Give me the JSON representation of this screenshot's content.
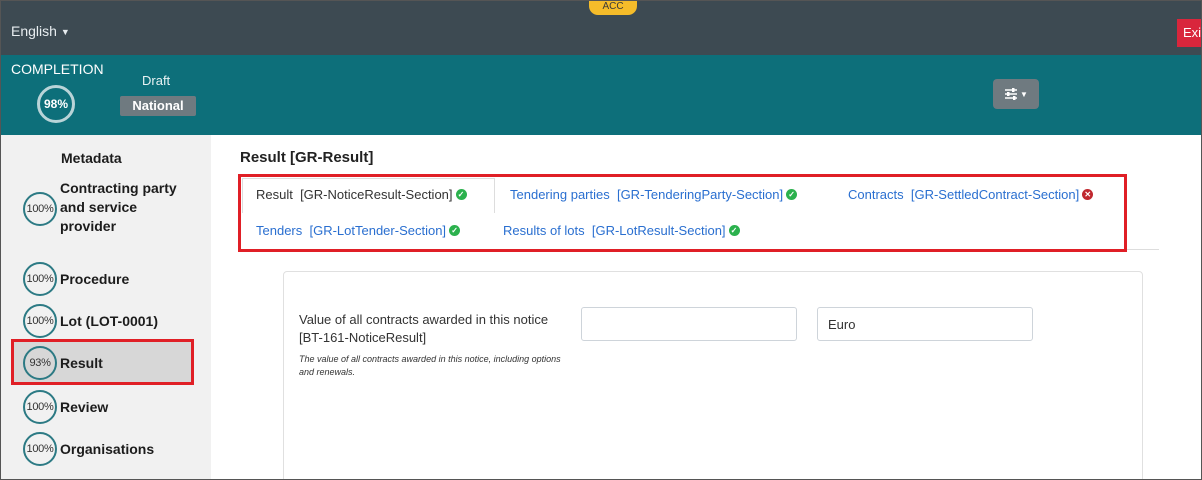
{
  "topbar": {
    "language": "English",
    "environment_badge": "ACC",
    "exit_label": "Exit"
  },
  "header": {
    "completion_label": "COMPLETION",
    "completion_percent": "98%",
    "status": "Draft",
    "scope_badge": "National"
  },
  "sidebar": {
    "items": [
      {
        "label": "Metadata",
        "percent": ""
      },
      {
        "label": "Contracting party and service provider",
        "percent": "100%"
      },
      {
        "label": "Procedure",
        "percent": "100%"
      },
      {
        "label": "Lot (LOT-0001)",
        "percent": "100%"
      },
      {
        "label": "Result",
        "percent": "93%"
      },
      {
        "label": "Review",
        "percent": "100%"
      },
      {
        "label": "Organisations",
        "percent": "100%"
      }
    ]
  },
  "main": {
    "title": "Result [GR-Result]",
    "tabs": [
      {
        "label": "Result  [GR-NoticeResult-Section]",
        "status": "ok"
      },
      {
        "label": "Tendering parties  [GR-TenderingParty-Section]",
        "status": "ok"
      },
      {
        "label": "Contracts  [GR-SettledContract-Section]",
        "status": "error"
      },
      {
        "label": "Tenders  [GR-LotTender-Section]",
        "status": "ok"
      },
      {
        "label": "Results of lots  [GR-LotResult-Section]",
        "status": "ok"
      }
    ],
    "field": {
      "label": "Value of all contracts awarded in this notice [BT-161-NoticeResult]",
      "help": "The value of all contracts awarded in this notice, including options and renewals.",
      "value": "",
      "currency": "Euro"
    }
  },
  "colors": {
    "topbar": "#3d4a52",
    "band": "#0d6f7a",
    "highlight": "#e01f26",
    "link": "#2a6fd0",
    "ok": "#2bb14d",
    "error": "#c0282f"
  },
  "icons": {
    "settings": "sliders-icon",
    "tab_ok": "check-circle-icon",
    "tab_error": "x-circle-icon"
  }
}
